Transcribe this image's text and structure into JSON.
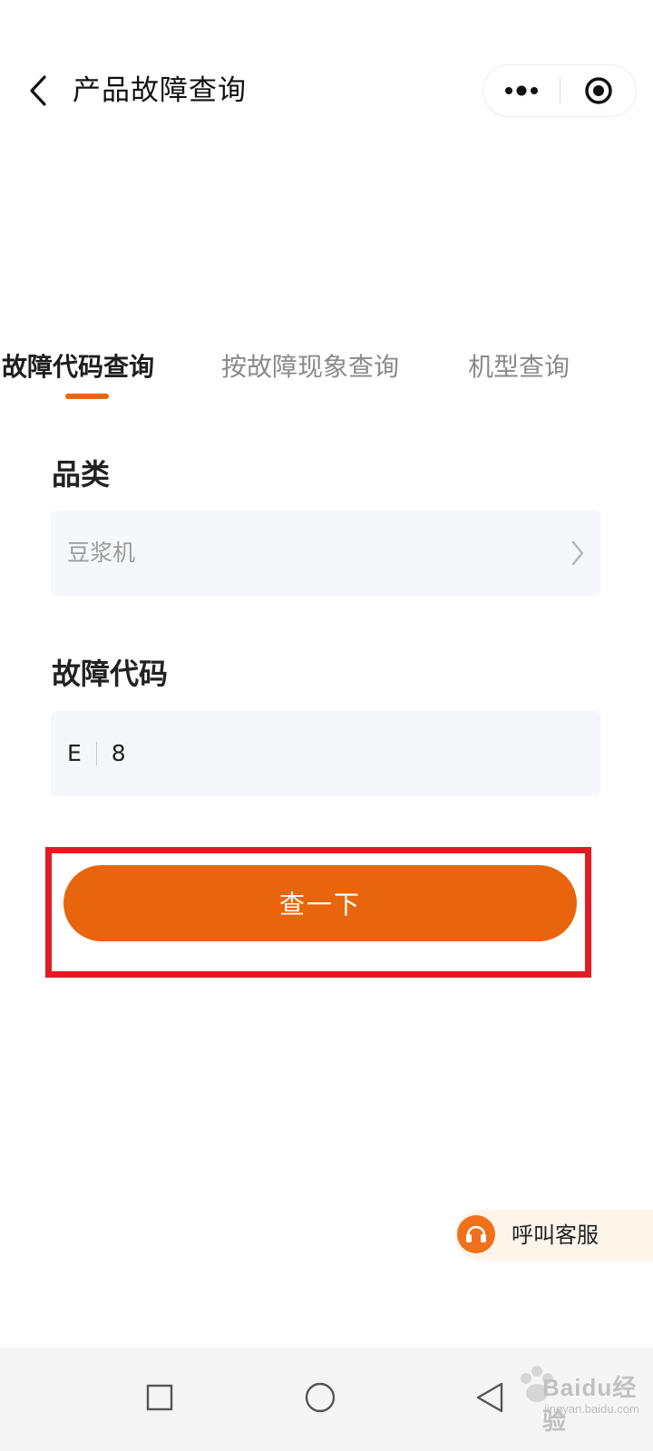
{
  "header": {
    "title": "产品故障查询"
  },
  "tabs": [
    {
      "label": "故障代码查询",
      "active": true
    },
    {
      "label": "按故障现象查询",
      "active": false
    },
    {
      "label": "机型查询",
      "active": false
    }
  ],
  "form": {
    "category": {
      "label": "品类",
      "value": "豆浆机"
    },
    "fault_code": {
      "label": "故障代码",
      "chars": [
        "E",
        "8"
      ]
    }
  },
  "query_button": {
    "label": "查一下"
  },
  "customer_service": {
    "label": "呼叫客服"
  },
  "colors": {
    "accent": "#e8650d",
    "highlight": "#e01b24",
    "field_bg": "#f6f7fb"
  },
  "icons": {
    "back": "back-chevron-icon",
    "more": "more-dots-icon",
    "close": "close-target-icon",
    "select": "chevron-right-icon",
    "service": "headset-icon",
    "nav_recent": "square-icon",
    "nav_home": "circle-icon",
    "nav_back": "triangle-back-icon"
  },
  "watermark": {
    "text": "Baidu经验",
    "sub": "jingyan.baidu.com"
  }
}
